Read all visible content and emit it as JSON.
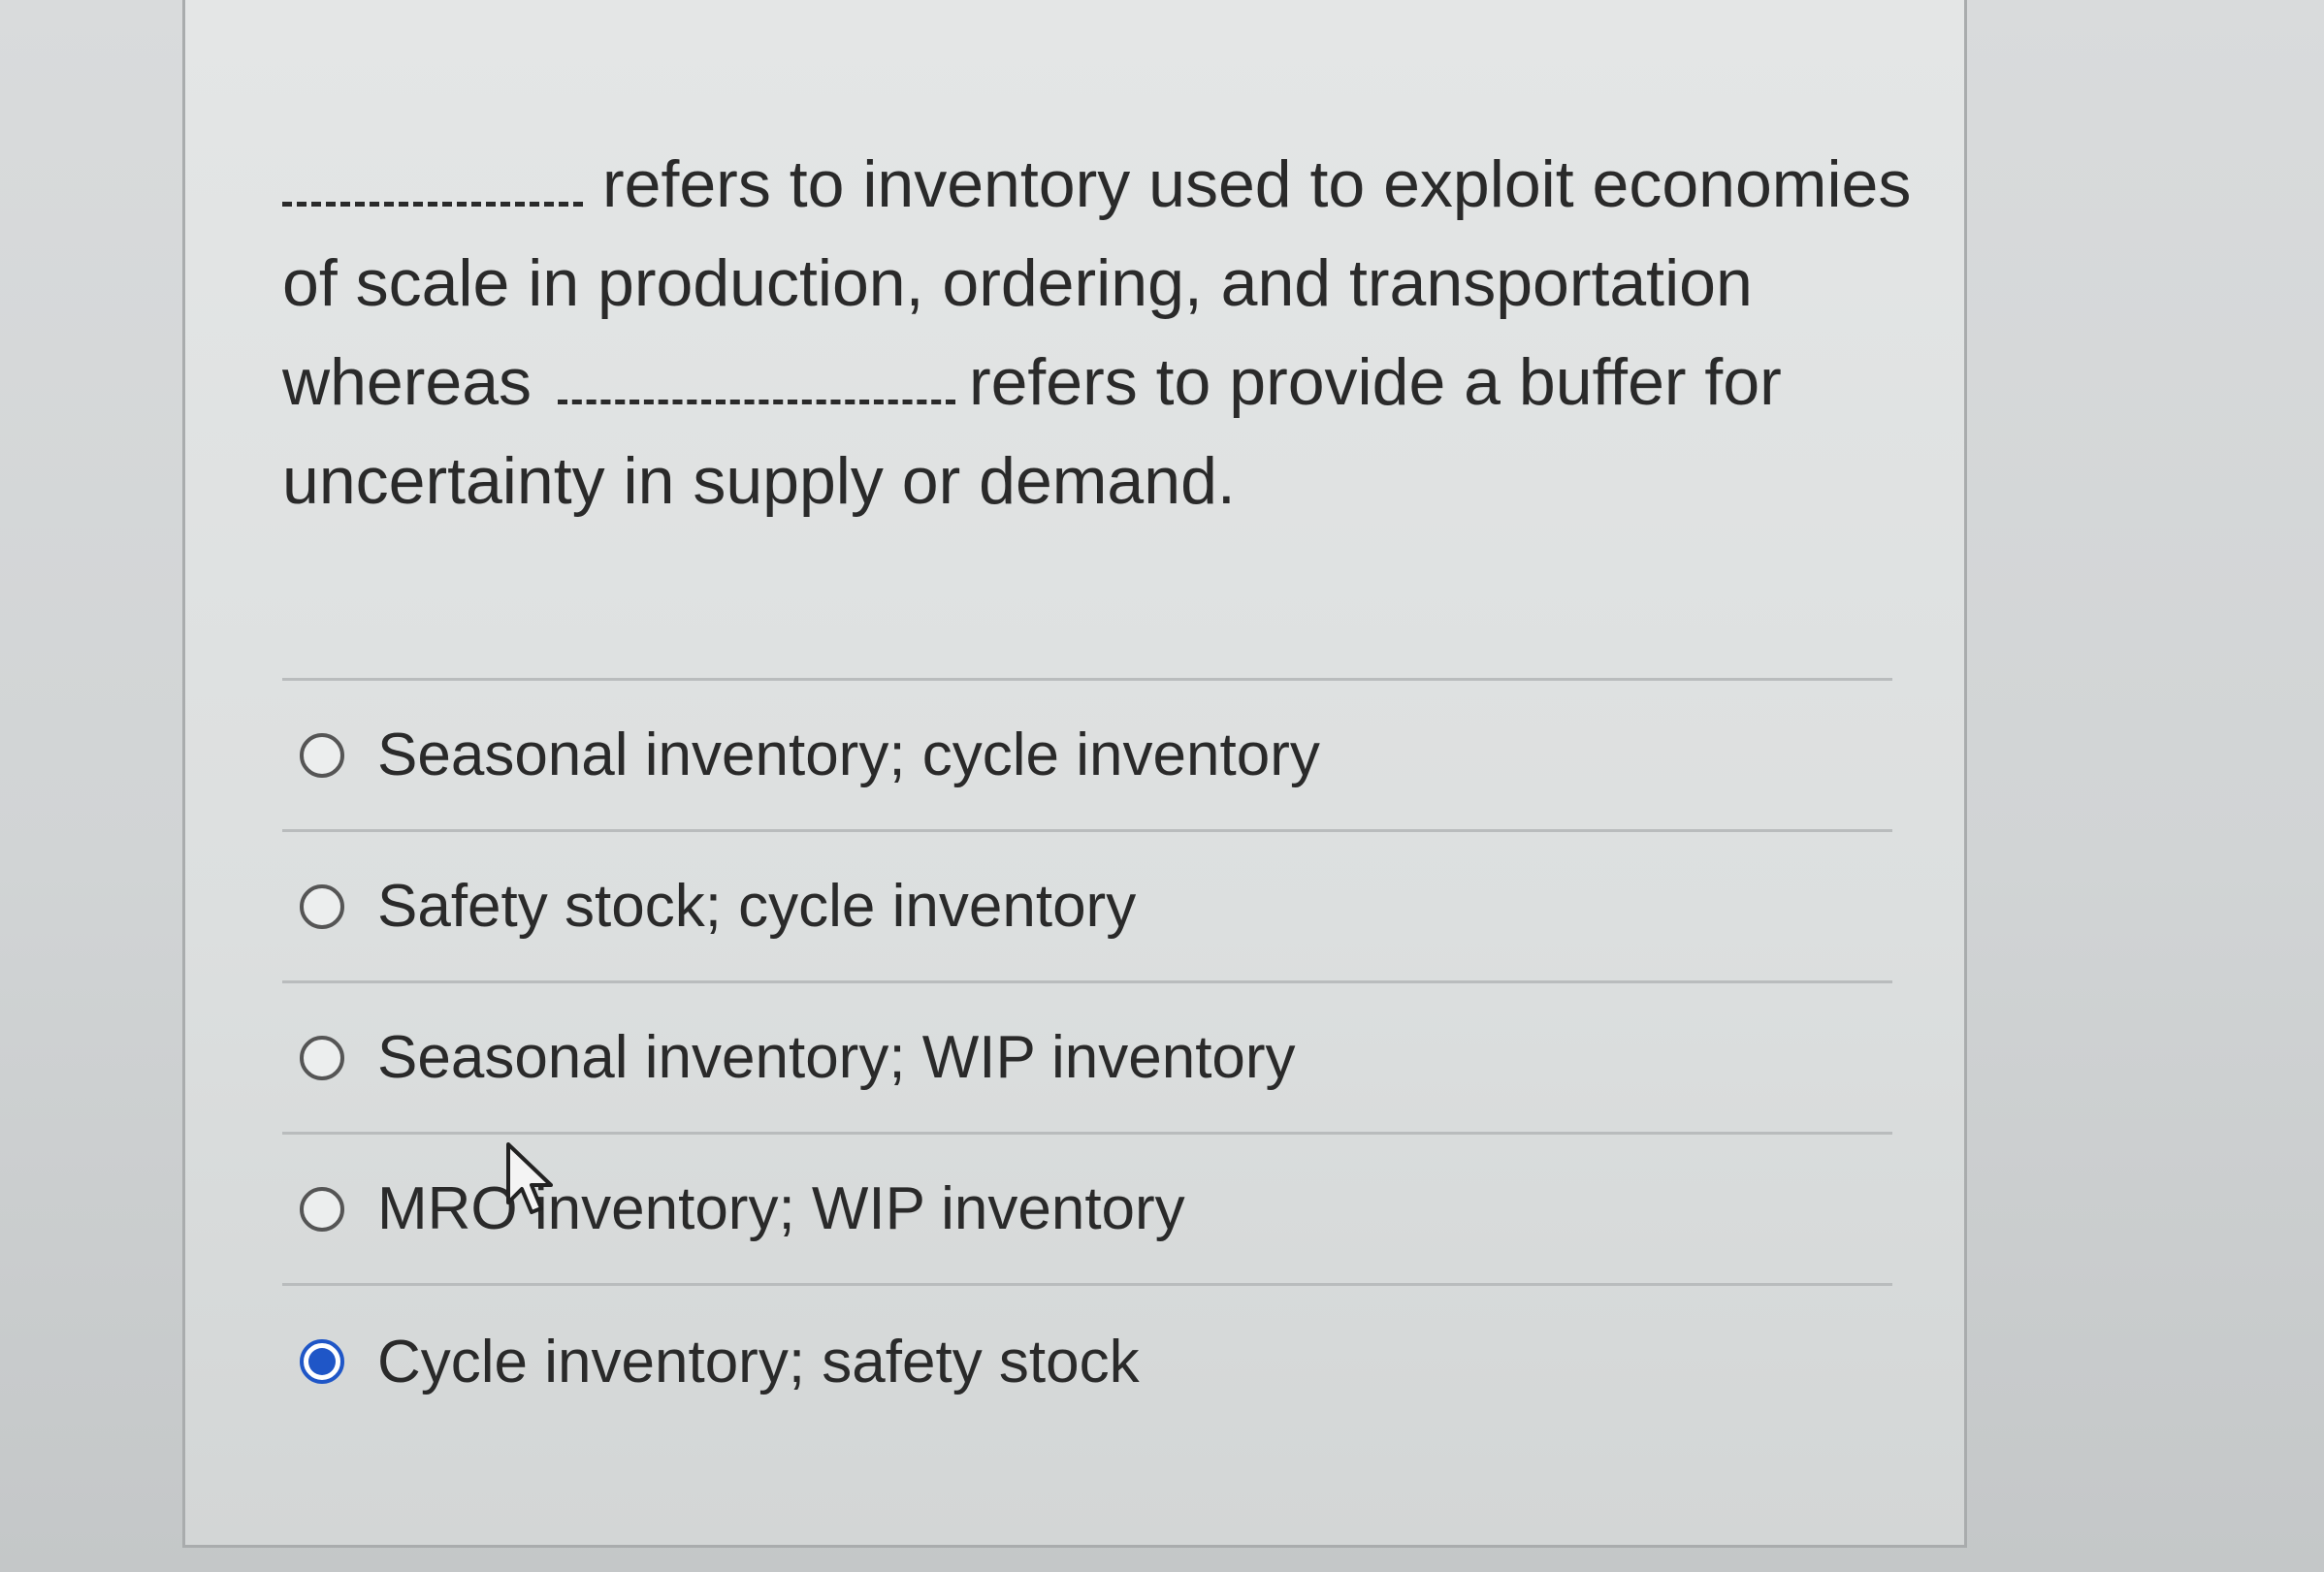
{
  "question": {
    "part1": "refers to inventory used to exploit economies of scale in production, ordering, and transportation whereas",
    "part2": "refers to provide a buffer for uncertainty in supply or demand."
  },
  "options": [
    {
      "label": "Seasonal inventory; cycle inventory",
      "selected": false
    },
    {
      "label": "Safety stock; cycle inventory",
      "selected": false
    },
    {
      "label": "Seasonal inventory; WIP inventory",
      "selected": false
    },
    {
      "label": "MRO inventory; WIP inventory",
      "selected": false
    },
    {
      "label": "Cycle inventory; safety stock",
      "selected": true
    }
  ],
  "colors": {
    "selected_radio": "#1f56c7",
    "text": "#2a2a2a",
    "divider": "#b9bcbd"
  },
  "icons": {
    "cursor": "mouse-pointer-icon"
  }
}
